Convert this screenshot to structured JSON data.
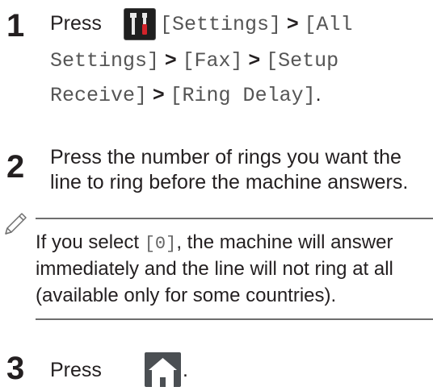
{
  "steps": [
    {
      "number": "1",
      "press_label": "Press",
      "settings_path": [
        "[Settings]",
        "[All",
        "Settings]",
        "[Fax]",
        "[Setup",
        "Receive]",
        "[Ring Delay]"
      ],
      "separator": ">",
      "end_period": "."
    },
    {
      "number": "2",
      "line1": "Press the number of rings you want the",
      "line2": "line to ring before the machine answers."
    },
    {
      "number": "3",
      "press_label": "Press",
      "end_period": "."
    }
  ],
  "note": {
    "line1_before": "If you select ",
    "line1_code": "[0]",
    "line1_after": ", the machine will answer",
    "line2": "immediately and the line will not ring at all",
    "line3": "(available only for some countries)."
  },
  "icons": {
    "settings": "settings-tools-icon",
    "home": "home-icon",
    "note": "pencil-note-icon"
  }
}
